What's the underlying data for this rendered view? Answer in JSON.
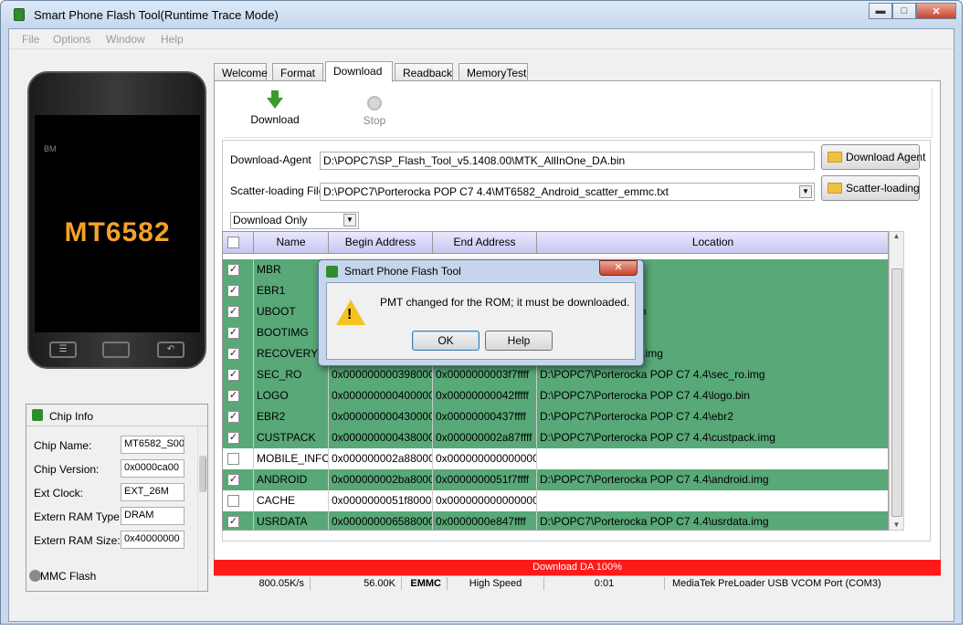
{
  "window": {
    "title": "Smart Phone Flash Tool(Runtime Trace Mode)",
    "controls": [
      "minimize-icon",
      "maximize-icon",
      "close-icon"
    ]
  },
  "menu": [
    "File",
    "Options",
    "Window",
    "Help"
  ],
  "phone": {
    "brand": "BM",
    "chip": "MT6582"
  },
  "chip_info": {
    "header": "Chip Info",
    "rows": [
      {
        "label": "Chip Name:",
        "value": "MT6582_S00"
      },
      {
        "label": "Chip Version:",
        "value": "0x0000ca00"
      },
      {
        "label": "Ext Clock:",
        "value": "EXT_26M"
      },
      {
        "label": "Extern RAM Type:",
        "value": "DRAM"
      },
      {
        "label": "Extern RAM Size:",
        "value": "0x40000000"
      }
    ],
    "footer": "EMMC Flash"
  },
  "tabs": [
    "Welcome",
    "Format",
    "Download",
    "Readback",
    "MemoryTest"
  ],
  "active_tab": "Download",
  "toolbar": {
    "download": "Download",
    "stop": "Stop"
  },
  "download_agent": {
    "label": "Download-Agent",
    "value": "D:\\POPC7\\SP_Flash_Tool_v5.1408.00\\MTK_AllInOne_DA.bin",
    "button": "Download Agent"
  },
  "scatter": {
    "label": "Scatter-loading File",
    "value": "D:\\POPC7\\Porterocka POP C7 4.4\\MT6582_Android_scatter_emmc.txt",
    "button": "Scatter-loading"
  },
  "mode": {
    "selected": "Download Only"
  },
  "table": {
    "columns": [
      "Name",
      "Begin Address",
      "End Address",
      "Location"
    ],
    "rows": [
      {
        "checked": true,
        "name": "MBR",
        "begin": "",
        "end": "",
        "location": "POP C7 4.4\\mbr"
      },
      {
        "checked": true,
        "name": "EBR1",
        "begin": "",
        "end": "",
        "location": "POP C7 4.4\\ebr1"
      },
      {
        "checked": true,
        "name": "UBOOT",
        "begin": "",
        "end": "",
        "location": "POP C7 4.4\\uboot.bin"
      },
      {
        "checked": true,
        "name": "BOOTIMG",
        "begin": "",
        "end": "",
        "location": "POP C7 4.4\\boot.img"
      },
      {
        "checked": true,
        "name": "RECOVERY",
        "begin": "",
        "end": "",
        "location": "POP C7 4.4\\recovery.img"
      },
      {
        "checked": true,
        "name": "SEC_RO",
        "begin": "0x0000000003980000",
        "end": "0x0000000003f7ffff",
        "location": "D:\\POPC7\\Porterocka POP C7 4.4\\sec_ro.img"
      },
      {
        "checked": true,
        "name": "LOGO",
        "begin": "0x0000000004000000",
        "end": "0x00000000042fffff",
        "location": "D:\\POPC7\\Porterocka POP C7 4.4\\logo.bin"
      },
      {
        "checked": true,
        "name": "EBR2",
        "begin": "0x0000000004300000",
        "end": "0x00000000437ffff",
        "location": "D:\\POPC7\\Porterocka POP C7 4.4\\ebr2"
      },
      {
        "checked": true,
        "name": "CUSTPACK",
        "begin": "0x0000000004380000",
        "end": "0x000000002a87ffff",
        "location": "D:\\POPC7\\Porterocka POP C7 4.4\\custpack.img"
      },
      {
        "checked": false,
        "name": "MOBILE_INFO",
        "begin": "0x000000002a880000",
        "end": "0x0000000000000000",
        "location": ""
      },
      {
        "checked": true,
        "name": "ANDROID",
        "begin": "0x000000002ba80000",
        "end": "0x0000000051f7ffff",
        "location": "D:\\POPC7\\Porterocka POP C7 4.4\\android.img"
      },
      {
        "checked": false,
        "name": "CACHE",
        "begin": "0x0000000051f80000",
        "end": "0x0000000000000000",
        "location": ""
      },
      {
        "checked": true,
        "name": "USRDATA",
        "begin": "0x0000000065880000",
        "end": "0x0000000e847ffff",
        "location": "D:\\POPC7\\Porterocka POP C7 4.4\\usrdata.img"
      }
    ]
  },
  "progress": {
    "label": "Download DA 100%",
    "percent": 100,
    "color": "#ff1a1a"
  },
  "status": {
    "speed": "800.05K/s",
    "size": "56.00K",
    "storage": "EMMC",
    "usb": "High Speed",
    "time": "0:01",
    "port": "MediaTek PreLoader USB VCOM Port (COM3)"
  },
  "dialog": {
    "title": "Smart Phone Flash Tool",
    "message": "PMT changed for the ROM; it must be downloaded.",
    "ok": "OK",
    "help": "Help"
  },
  "colors": {
    "row_green": "#58a878",
    "header_lavender": "#c7c7f0",
    "chip_orange": "#f4a12a"
  }
}
